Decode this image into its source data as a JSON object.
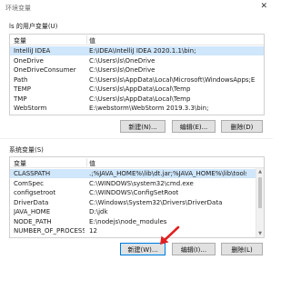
{
  "window": {
    "title": "环境变量",
    "close_glyph": "✕"
  },
  "user_section": {
    "label": "ls 的用户变量(U)",
    "columns": [
      "变量",
      "值"
    ],
    "rows": [
      {
        "name": "IntelliJ IDEA",
        "value": "E:\\IDEA\\IntelliJ IDEA 2020.1.1\\bin;",
        "selected": true
      },
      {
        "name": "OneDrive",
        "value": "C:\\Users\\ls\\OneDrive"
      },
      {
        "name": "OneDriveConsumer",
        "value": "C:\\Users\\ls\\OneDrive"
      },
      {
        "name": "Path",
        "value": "C:\\Users\\ls\\AppData\\Local\\Microsoft\\WindowsApps;E:\\vs co..."
      },
      {
        "name": "TEMP",
        "value": "C:\\Users\\ls\\AppData\\Local\\Temp"
      },
      {
        "name": "TMP",
        "value": "C:\\Users\\ls\\AppData\\Local\\Temp"
      },
      {
        "name": "WebStorm",
        "value": "E:\\webstorm\\WebStorm 2019.3.3\\bin;"
      }
    ],
    "buttons": {
      "new": "新建(N)...",
      "edit": "编辑(E)...",
      "delete": "删除(D)"
    }
  },
  "system_section": {
    "label": "系统变量(S)",
    "columns": [
      "变量",
      "值"
    ],
    "rows": [
      {
        "name": "CLASSPATH",
        "value": ".;%JAVA_HOME%\\lib\\dt.jar;%JAVA_HOME%\\lib\\tools.jar;",
        "selected": true
      },
      {
        "name": "ComSpec",
        "value": "C:\\WINDOWS\\system32\\cmd.exe"
      },
      {
        "name": "configsetroot",
        "value": "C:\\WINDOWS\\ConfigSetRoot"
      },
      {
        "name": "DriverData",
        "value": "C:\\Windows\\System32\\Drivers\\DriverData"
      },
      {
        "name": "JAVA_HOME",
        "value": "D:\\jdk"
      },
      {
        "name": "NODE_PATH",
        "value": "E:\\nodejs\\node_modules"
      },
      {
        "name": "NUMBER_OF_PROCESSORS",
        "value": "12"
      }
    ],
    "buttons": {
      "new": "新建(W)...",
      "edit": "编辑(I)...",
      "delete": "删除(L)"
    }
  },
  "icons": {
    "scroll_up": "▲",
    "scroll_down": "▼",
    "annotation": "red-arrow-icon"
  },
  "colors": {
    "selection": "#cfe6fb",
    "annotation_arrow": "#e02020",
    "focus_border": "#0078d7"
  }
}
